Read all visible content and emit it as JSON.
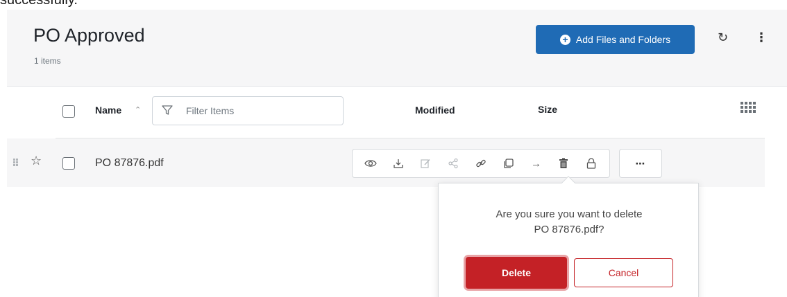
{
  "top_message": {
    "text": "successfully."
  },
  "header": {
    "title": "PO Approved",
    "item_count": "1 items",
    "add_button_label": "Add Files and Folders",
    "accent_color": "#1f6bb5"
  },
  "columns": {
    "name": "Name",
    "filter_placeholder": "Filter Items",
    "modified": "Modified",
    "size": "Size"
  },
  "rows": [
    {
      "name": "PO 87876.pdf",
      "modified": "",
      "size": ""
    }
  ],
  "row_actions": [
    {
      "icon": "eye-icon",
      "enabled": true
    },
    {
      "icon": "download-icon",
      "enabled": true
    },
    {
      "icon": "edit-icon",
      "enabled": false
    },
    {
      "icon": "share-icon",
      "enabled": false
    },
    {
      "icon": "link-icon",
      "enabled": true
    },
    {
      "icon": "copy-icon",
      "enabled": true
    },
    {
      "icon": "move-arrow-icon",
      "enabled": true
    },
    {
      "icon": "trash-icon",
      "enabled": true
    },
    {
      "icon": "lock-icon",
      "enabled": true
    }
  ],
  "delete_confirm": {
    "message_line1": "Are you sure you want to delete",
    "message_line2": "PO 87876.pdf?",
    "delete_label": "Delete",
    "cancel_label": "Cancel",
    "danger_color": "#c42126"
  }
}
